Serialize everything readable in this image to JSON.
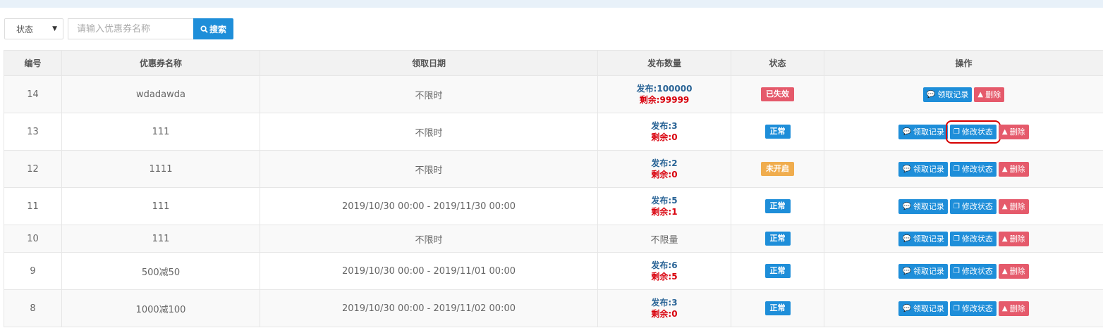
{
  "colors": {
    "primary": "#1e8ed9",
    "danger": "#e55a6b",
    "warning": "#f0ad4e",
    "pub_text": "#2a6496",
    "rem_text": "#d9000c"
  },
  "filters": {
    "status_select": "状态",
    "search_placeholder": "请输入优惠券名称",
    "search_button": "搜索"
  },
  "table": {
    "headers": [
      "编号",
      "优惠券名称",
      "领取日期",
      "发布数量",
      "状态",
      "操作"
    ],
    "rows": [
      {
        "id": "14",
        "name": "wdadawda",
        "date": "不限时",
        "pub": "发布:100000",
        "rem": "剩余:99999",
        "qty": "",
        "status": "已失效",
        "status_color": "#e55a6b"
      },
      {
        "id": "13",
        "name": "111",
        "date": "不限时",
        "pub": "发布:3",
        "rem": "剩余:0",
        "qty": "",
        "status": "正常",
        "status_color": "#1e8ed9"
      },
      {
        "id": "12",
        "name": "1111",
        "date": "不限时",
        "pub": "发布:2",
        "rem": "剩余:0",
        "qty": "",
        "status": "未开启",
        "status_color": "#f0ad4e"
      },
      {
        "id": "11",
        "name": "111",
        "date": "2019/10/30 00:00 - 2019/11/30 00:00",
        "pub": "发布:5",
        "rem": "剩余:1",
        "qty": "",
        "status": "正常",
        "status_color": "#1e8ed9"
      },
      {
        "id": "10",
        "name": "111",
        "date": "不限时",
        "pub": "",
        "rem": "",
        "qty": "不限量",
        "status": "正常",
        "status_color": "#1e8ed9"
      },
      {
        "id": "9",
        "name": "500减50",
        "date": "2019/10/30 00:00 - 2019/11/01 00:00",
        "pub": "发布:6",
        "rem": "剩余:5",
        "qty": "",
        "status": "正常",
        "status_color": "#1e8ed9"
      },
      {
        "id": "8",
        "name": "1000减100",
        "date": "2019/10/30 00:00 - 2019/11/02 00:00",
        "pub": "发布:3",
        "rem": "剩余:0",
        "qty": "",
        "status": "正常",
        "status_color": "#1e8ed9"
      }
    ]
  },
  "actions": {
    "records": "领取记录",
    "modify": "修改状态",
    "delete": "删除"
  }
}
